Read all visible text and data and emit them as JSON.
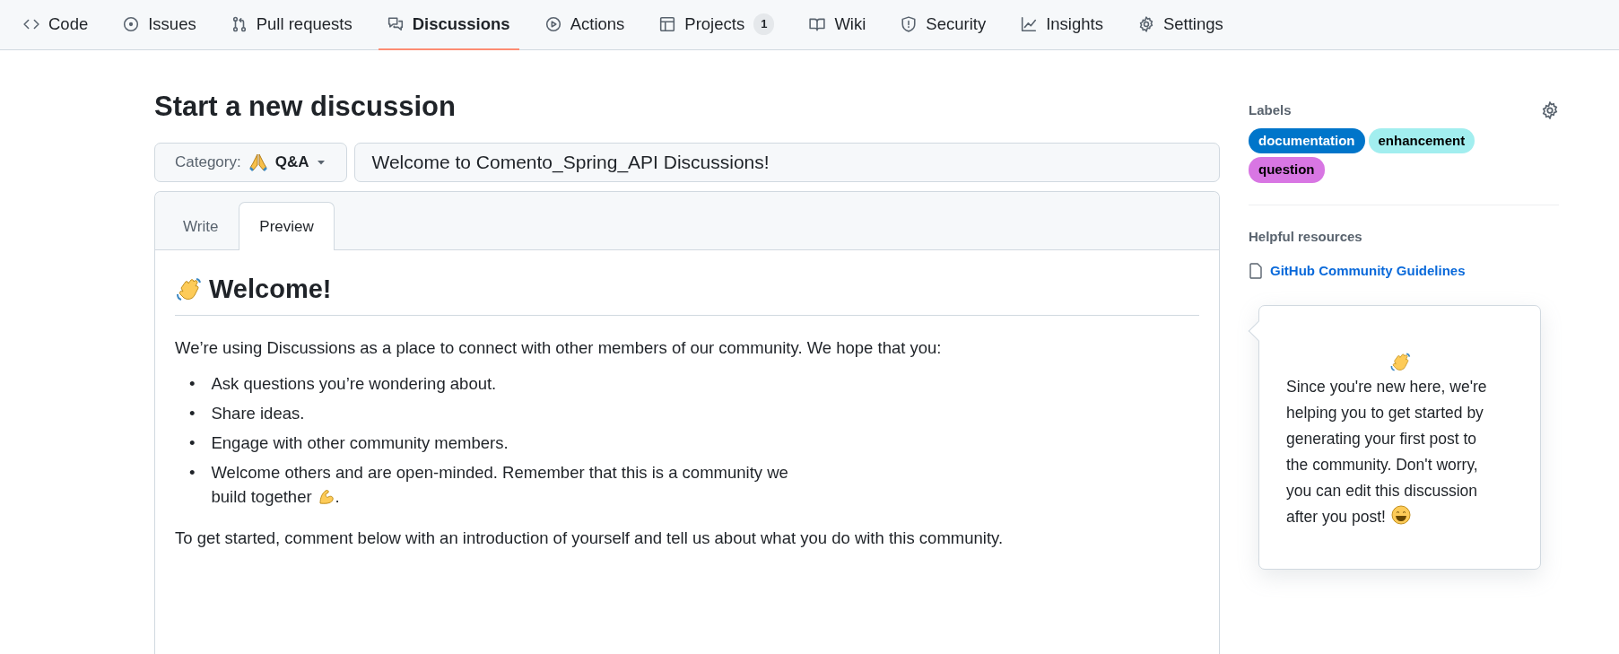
{
  "repo_nav": [
    {
      "label": "Code",
      "selected": false
    },
    {
      "label": "Issues",
      "selected": false
    },
    {
      "label": "Pull requests",
      "selected": false
    },
    {
      "label": "Discussions",
      "selected": true
    },
    {
      "label": "Actions",
      "selected": false
    },
    {
      "label": "Projects",
      "selected": false,
      "count": "1"
    },
    {
      "label": "Wiki",
      "selected": false
    },
    {
      "label": "Security",
      "selected": false
    },
    {
      "label": "Insights",
      "selected": false
    },
    {
      "label": "Settings",
      "selected": false
    }
  ],
  "page_title": "Start a new discussion",
  "category": {
    "label": "Category:",
    "value": "Q&A"
  },
  "title_field": {
    "value": "Welcome to Comento_Spring_API Discussions!"
  },
  "editor_tabs": [
    {
      "label": "Write",
      "selected": false
    },
    {
      "label": "Preview",
      "selected": true
    }
  ],
  "preview": {
    "heading": "Welcome!",
    "intro": "We’re using Discussions as a place to connect with other members of our community. We hope that you:",
    "bullets": [
      {
        "marker": "•",
        "text": "Ask questions you’re wondering about."
      },
      {
        "marker": "•",
        "text": "Share ideas."
      },
      {
        "marker": "•",
        "text": "Engage with other community members."
      },
      {
        "marker": "•",
        "text": "Welcome others and are open-minded. Remember that this is a community we",
        "continuation": "build together",
        "after_icon": "."
      }
    ],
    "outro": "To get started, comment below with an introduction of yourself and tell us about what you do with this community."
  },
  "sidebar": {
    "labels_heading": "Labels",
    "labels": [
      {
        "name": "documentation",
        "color": "#0075ca"
      },
      {
        "name": "enhancement",
        "color": "#a2eeef"
      },
      {
        "name": "question",
        "color": "#d876e3"
      }
    ],
    "resources_heading": "Helpful resources",
    "resources": [
      {
        "label": "GitHub Community Guidelines"
      }
    ],
    "popover": {
      "text": "Since you're new here, we're helping you to get started by generating your first post to the community. Don't worry, you can edit this discussion",
      "last_line": "after you post!"
    }
  }
}
